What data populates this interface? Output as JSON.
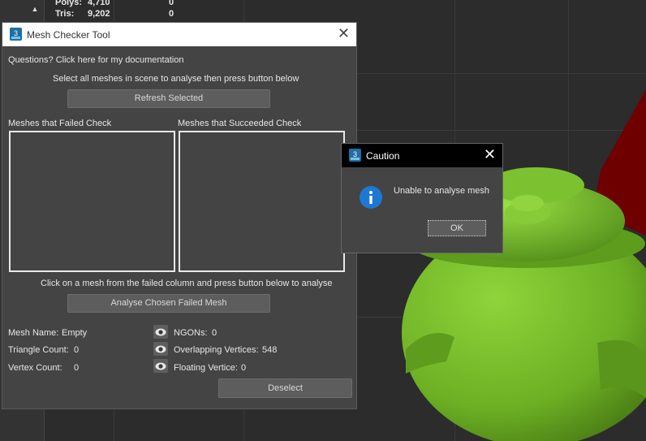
{
  "viewport": {
    "stats": [
      {
        "label": "Polys:",
        "value": "4,710",
        "selected": "0"
      },
      {
        "label": "Tris:",
        "value": "9,202",
        "selected": "0"
      }
    ],
    "scroll_glyph": "▲"
  },
  "tool_window": {
    "title": "Mesh Checker Tool",
    "app_icon_text": "3",
    "close_glyph": "✕",
    "doc_link": "Questions? Click here for my documentation",
    "instruction": "Select all meshes in scene to analyse then press button below",
    "refresh_button": "Refresh Selected",
    "failed_header": "Meshes that Failed Check",
    "succeeded_header": "Meshes that Succeeded Check",
    "analyse_instruction": "Click on a mesh from the failed column and press button below to analyse",
    "analyse_button": "Analyse Chosen Failed Mesh",
    "mesh_name_label": "Mesh Name:",
    "mesh_name_value": "Empty",
    "triangle_label": "Triangle Count:",
    "triangle_value": "0",
    "vertex_label": "Vertex Count:",
    "vertex_value": "0",
    "ngons_label": "NGONs:",
    "ngons_value": "0",
    "overlap_label": "Overlapping Vertices:",
    "overlap_value": "548",
    "floating_label": "Floating Vertice:",
    "floating_value": "0",
    "deselect_button": "Deselect"
  },
  "caution_dialog": {
    "title": "Caution",
    "app_icon_text": "3",
    "close_glyph": "✕",
    "message": "Unable to analyse mesh",
    "ok_button": "OK",
    "icon": "info-icon"
  },
  "colors": {
    "teapot": "#6db024",
    "dialog_bg": "#444444",
    "info_blue": "#1e78d2"
  }
}
